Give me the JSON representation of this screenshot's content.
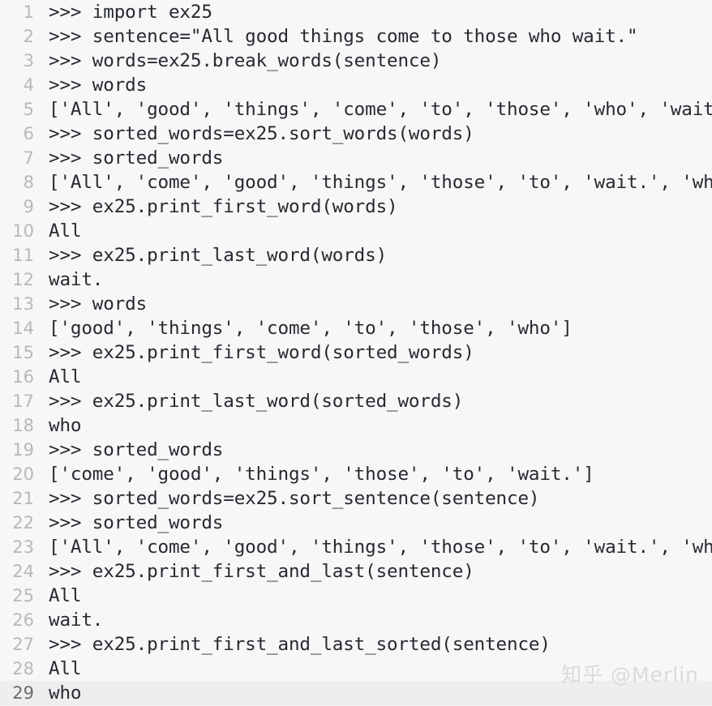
{
  "code_block": {
    "language": "python-repl",
    "background_color": "#f7f7f8",
    "text_color": "#262a30",
    "line_number_color": "#b6b8ba",
    "highlight_color": "#eeeeef",
    "highlighted_line": 29,
    "lines": [
      {
        "number": "1",
        "text": ">>> import ex25"
      },
      {
        "number": "2",
        "text": ">>> sentence=\"All good things come to those who wait.\""
      },
      {
        "number": "3",
        "text": ">>> words=ex25.break_words(sentence)"
      },
      {
        "number": "4",
        "text": ">>> words"
      },
      {
        "number": "5",
        "text": "['All', 'good', 'things', 'come', 'to', 'those', 'who', 'wait.']"
      },
      {
        "number": "6",
        "text": ">>> sorted_words=ex25.sort_words(words)"
      },
      {
        "number": "7",
        "text": ">>> sorted_words"
      },
      {
        "number": "8",
        "text": "['All', 'come', 'good', 'things', 'those', 'to', 'wait.', 'who']"
      },
      {
        "number": "9",
        "text": ">>> ex25.print_first_word(words)"
      },
      {
        "number": "10",
        "text": "All"
      },
      {
        "number": "11",
        "text": ">>> ex25.print_last_word(words)"
      },
      {
        "number": "12",
        "text": "wait."
      },
      {
        "number": "13",
        "text": ">>> words"
      },
      {
        "number": "14",
        "text": "['good', 'things', 'come', 'to', 'those', 'who']"
      },
      {
        "number": "15",
        "text": ">>> ex25.print_first_word(sorted_words)"
      },
      {
        "number": "16",
        "text": "All"
      },
      {
        "number": "17",
        "text": ">>> ex25.print_last_word(sorted_words)"
      },
      {
        "number": "18",
        "text": "who"
      },
      {
        "number": "19",
        "text": ">>> sorted_words"
      },
      {
        "number": "20",
        "text": "['come', 'good', 'things', 'those', 'to', 'wait.']"
      },
      {
        "number": "21",
        "text": ">>> sorted_words=ex25.sort_sentence(sentence)"
      },
      {
        "number": "22",
        "text": ">>> sorted_words"
      },
      {
        "number": "23",
        "text": "['All', 'come', 'good', 'things', 'those', 'to', 'wait.', 'who']"
      },
      {
        "number": "24",
        "text": ">>> ex25.print_first_and_last(sentence)"
      },
      {
        "number": "25",
        "text": "All"
      },
      {
        "number": "26",
        "text": "wait."
      },
      {
        "number": "27",
        "text": ">>> ex25.print_first_and_last_sorted(sentence)"
      },
      {
        "number": "28",
        "text": "All"
      },
      {
        "number": "29",
        "text": "who"
      }
    ]
  },
  "watermark": {
    "text": "知乎 @Merlin"
  }
}
